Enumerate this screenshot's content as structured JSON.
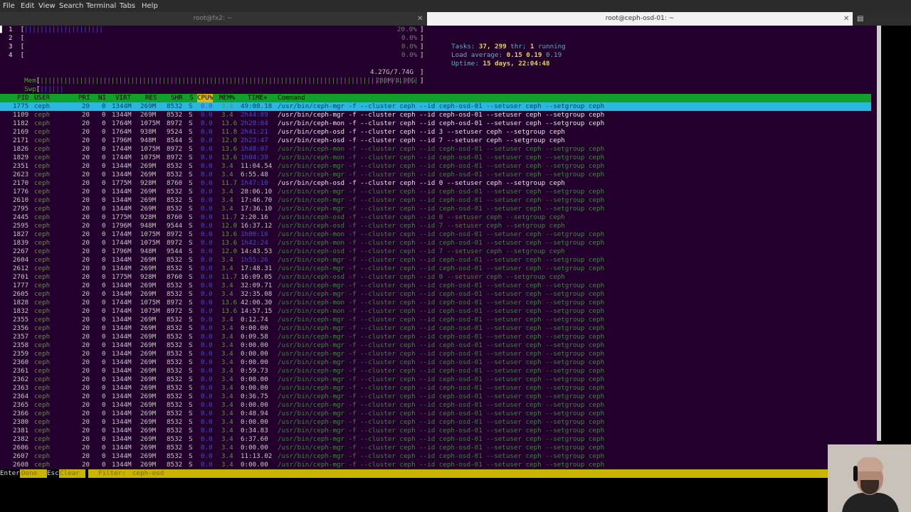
{
  "menu": [
    "File",
    "Edit",
    "View",
    "Search",
    "Terminal",
    "Tabs",
    "Help"
  ],
  "tabs": [
    {
      "title": "root@fx2: ~",
      "active": false
    },
    {
      "title": "root@ceph-osd-01: ~",
      "active": true
    }
  ],
  "meters": {
    "cpus": [
      {
        "label": "1",
        "value": "20.0%"
      },
      {
        "label": "2",
        "value": "0.0%"
      },
      {
        "label": "3",
        "value": "0.0%"
      },
      {
        "label": "4",
        "value": "0.0%"
      }
    ],
    "mem": {
      "label": "Mem",
      "value": "4.27G/7.74G"
    },
    "swp": {
      "label": "Swp",
      "value": "280M/4.00G"
    }
  },
  "summary": {
    "tasks_label": "Tasks:",
    "tasks": "37,",
    "threads": "299",
    "thr_label": "thr;",
    "running": "1",
    "running_label": "running",
    "load_label": "Load average:",
    "load1": "0.15",
    "load5": "0.19",
    "load15": "0.19",
    "uptime_label": "Uptime:",
    "uptime": "15 days, 22:04:48"
  },
  "columns": [
    "PID",
    "USER",
    "PRI",
    "NI",
    "VIRT",
    "RES",
    "SHR",
    "S",
    "CPU%",
    "MEM%",
    "TIME+",
    "Command"
  ],
  "rows": [
    {
      "pid": "1775",
      "user": "ceph",
      "pri": "20",
      "ni": "0",
      "virt": "1344M",
      "res": "269M",
      "shr": "8532",
      "s": "S",
      "cpu": "0.0",
      "mem": "3.4",
      "time": "49:08.18",
      "cmd": "/usr/bin/ceph-mgr -f --cluster ceph --id ceph-osd-01 --setuser ceph --setgroup ceph",
      "kind": "sel"
    },
    {
      "pid": "1109",
      "user": "ceph",
      "pri": "20",
      "ni": "0",
      "virt": "1344M",
      "res": "269M",
      "shr": "8532",
      "s": "S",
      "cpu": "0.0",
      "mem": "3.4",
      "time": "2h44:09",
      "cmd": "/usr/bin/ceph-mgr -f --cluster ceph --id ceph-osd-01 --setuser ceph --setgroup ceph",
      "kind": "proc"
    },
    {
      "pid": "1182",
      "user": "ceph",
      "pri": "20",
      "ni": "0",
      "virt": "1764M",
      "res": "1075M",
      "shr": "8972",
      "s": "S",
      "cpu": "0.0",
      "mem": "13.6",
      "time": "2h28:04",
      "cmd": "/usr/bin/ceph-mon -f --cluster ceph --id ceph-osd-01 --setuser ceph --setgroup ceph",
      "kind": "proc"
    },
    {
      "pid": "2169",
      "user": "ceph",
      "pri": "20",
      "ni": "0",
      "virt": "1764M",
      "res": "938M",
      "shr": "9524",
      "s": "S",
      "cpu": "0.0",
      "mem": "11.8",
      "time": "2h41:21",
      "cmd": "/usr/bin/ceph-osd -f --cluster ceph --id 3 --setuser ceph --setgroup ceph",
      "kind": "proc"
    },
    {
      "pid": "2171",
      "user": "ceph",
      "pri": "20",
      "ni": "0",
      "virt": "1796M",
      "res": "948M",
      "shr": "8544",
      "s": "S",
      "cpu": "0.0",
      "mem": "12.0",
      "time": "2h23:47",
      "cmd": "/usr/bin/ceph-osd -f --cluster ceph --id 7 --setuser ceph --setgroup ceph",
      "kind": "proc"
    },
    {
      "pid": "1826",
      "user": "ceph",
      "pri": "20",
      "ni": "0",
      "virt": "1744M",
      "res": "1075M",
      "shr": "8972",
      "s": "S",
      "cpu": "0.0",
      "mem": "13.6",
      "time": "1h48:07",
      "cmd": "/usr/bin/ceph-mon -f --cluster ceph --id ceph-osd-01 --setuser ceph --setgroup ceph",
      "kind": "thread"
    },
    {
      "pid": "1829",
      "user": "ceph",
      "pri": "20",
      "ni": "0",
      "virt": "1744M",
      "res": "1075M",
      "shr": "8972",
      "s": "S",
      "cpu": "0.0",
      "mem": "13.6",
      "time": "1h04:39",
      "cmd": "/usr/bin/ceph-mon -f --cluster ceph --id ceph-osd-01 --setuser ceph --setgroup ceph",
      "kind": "thread"
    },
    {
      "pid": "2351",
      "user": "ceph",
      "pri": "20",
      "ni": "0",
      "virt": "1344M",
      "res": "269M",
      "shr": "8532",
      "s": "S",
      "cpu": "0.0",
      "mem": "3.4",
      "time": "11:04.54",
      "cmd": "/usr/bin/ceph-mgr -f --cluster ceph --id ceph-osd-01 --setuser ceph --setgroup ceph",
      "kind": "thread"
    },
    {
      "pid": "2623",
      "user": "ceph",
      "pri": "20",
      "ni": "0",
      "virt": "1344M",
      "res": "269M",
      "shr": "8532",
      "s": "S",
      "cpu": "0.0",
      "mem": "3.4",
      "time": "6:55.48",
      "cmd": "/usr/bin/ceph-mgr -f --cluster ceph --id ceph-osd-01 --setuser ceph --setgroup ceph",
      "kind": "thread"
    },
    {
      "pid": "2170",
      "user": "ceph",
      "pri": "20",
      "ni": "0",
      "virt": "1775M",
      "res": "928M",
      "shr": "8760",
      "s": "S",
      "cpu": "0.0",
      "mem": "11.7",
      "time": "1h47:10",
      "cmd": "/usr/bin/ceph-osd -f --cluster ceph --id 0 --setuser ceph --setgroup ceph",
      "kind": "proc"
    },
    {
      "pid": "1776",
      "user": "ceph",
      "pri": "20",
      "ni": "0",
      "virt": "1344M",
      "res": "269M",
      "shr": "8532",
      "s": "S",
      "cpu": "0.0",
      "mem": "3.4",
      "time": "28:06.10",
      "cmd": "/usr/bin/ceph-mgr -f --cluster ceph --id ceph-osd-01 --setuser ceph --setgroup ceph",
      "kind": "thread"
    },
    {
      "pid": "2610",
      "user": "ceph",
      "pri": "20",
      "ni": "0",
      "virt": "1344M",
      "res": "269M",
      "shr": "8532",
      "s": "S",
      "cpu": "0.0",
      "mem": "3.4",
      "time": "17:46.70",
      "cmd": "/usr/bin/ceph-mgr -f --cluster ceph --id ceph-osd-01 --setuser ceph --setgroup ceph",
      "kind": "thread"
    },
    {
      "pid": "2795",
      "user": "ceph",
      "pri": "20",
      "ni": "0",
      "virt": "1344M",
      "res": "269M",
      "shr": "8532",
      "s": "S",
      "cpu": "0.0",
      "mem": "3.4",
      "time": "17:36.10",
      "cmd": "/usr/bin/ceph-mgr -f --cluster ceph --id ceph-osd-01 --setuser ceph --setgroup ceph",
      "kind": "thread"
    },
    {
      "pid": "2445",
      "user": "ceph",
      "pri": "20",
      "ni": "0",
      "virt": "1775M",
      "res": "928M",
      "shr": "8760",
      "s": "S",
      "cpu": "0.0",
      "mem": "11.7",
      "time": "2:20.16",
      "cmd": "/usr/bin/ceph-osd -f --cluster ceph --id 0 --setuser ceph --setgroup ceph",
      "kind": "thread"
    },
    {
      "pid": "2595",
      "user": "ceph",
      "pri": "20",
      "ni": "0",
      "virt": "1796M",
      "res": "948M",
      "shr": "9544",
      "s": "S",
      "cpu": "0.0",
      "mem": "12.0",
      "time": "16:37.12",
      "cmd": "/usr/bin/ceph-osd -f --cluster ceph --id 7 --setuser ceph --setgroup ceph",
      "kind": "thread"
    },
    {
      "pid": "1827",
      "user": "ceph",
      "pri": "20",
      "ni": "0",
      "virt": "1744M",
      "res": "1075M",
      "shr": "8972",
      "s": "S",
      "cpu": "0.0",
      "mem": "13.6",
      "time": "1h00:16",
      "cmd": "/usr/bin/ceph-mon -f --cluster ceph --id ceph-osd-01 --setuser ceph --setgroup ceph",
      "kind": "thread"
    },
    {
      "pid": "1839",
      "user": "ceph",
      "pri": "20",
      "ni": "0",
      "virt": "1744M",
      "res": "1075M",
      "shr": "8972",
      "s": "S",
      "cpu": "0.0",
      "mem": "13.6",
      "time": "1h42:24",
      "cmd": "/usr/bin/ceph-mon -f --cluster ceph --id ceph-osd-01 --setuser ceph --setgroup ceph",
      "kind": "thread"
    },
    {
      "pid": "2267",
      "user": "ceph",
      "pri": "20",
      "ni": "0",
      "virt": "1796M",
      "res": "948M",
      "shr": "9544",
      "s": "S",
      "cpu": "0.0",
      "mem": "12.0",
      "time": "14:43.53",
      "cmd": "/usr/bin/ceph-osd -f --cluster ceph --id 7 --setuser ceph --setgroup ceph",
      "kind": "thread"
    },
    {
      "pid": "2604",
      "user": "ceph",
      "pri": "20",
      "ni": "0",
      "virt": "1344M",
      "res": "269M",
      "shr": "8532",
      "s": "S",
      "cpu": "0.0",
      "mem": "3.4",
      "time": "1h55:26",
      "cmd": "/usr/bin/ceph-mgr -f --cluster ceph --id ceph-osd-01 --setuser ceph --setgroup ceph",
      "kind": "thread"
    },
    {
      "pid": "2612",
      "user": "ceph",
      "pri": "20",
      "ni": "0",
      "virt": "1344M",
      "res": "269M",
      "shr": "8532",
      "s": "S",
      "cpu": "0.0",
      "mem": "3.4",
      "time": "17:48.31",
      "cmd": "/usr/bin/ceph-mgr -f --cluster ceph --id ceph-osd-01 --setuser ceph --setgroup ceph",
      "kind": "thread"
    },
    {
      "pid": "2701",
      "user": "ceph",
      "pri": "20",
      "ni": "0",
      "virt": "1775M",
      "res": "928M",
      "shr": "8760",
      "s": "S",
      "cpu": "0.0",
      "mem": "11.7",
      "time": "16:09.05",
      "cmd": "/usr/bin/ceph-osd -f --cluster ceph --id 0 --setuser ceph --setgroup ceph",
      "kind": "thread"
    },
    {
      "pid": "1777",
      "user": "ceph",
      "pri": "20",
      "ni": "0",
      "virt": "1344M",
      "res": "269M",
      "shr": "8532",
      "s": "S",
      "cpu": "0.0",
      "mem": "3.4",
      "time": "32:09.71",
      "cmd": "/usr/bin/ceph-mgr -f --cluster ceph --id ceph-osd-01 --setuser ceph --setgroup ceph",
      "kind": "thread"
    },
    {
      "pid": "2605",
      "user": "ceph",
      "pri": "20",
      "ni": "0",
      "virt": "1344M",
      "res": "269M",
      "shr": "8532",
      "s": "S",
      "cpu": "0.0",
      "mem": "3.4",
      "time": "32:35.08",
      "cmd": "/usr/bin/ceph-mgr -f --cluster ceph --id ceph-osd-01 --setuser ceph --setgroup ceph",
      "kind": "thread"
    },
    {
      "pid": "1828",
      "user": "ceph",
      "pri": "20",
      "ni": "0",
      "virt": "1744M",
      "res": "1075M",
      "shr": "8972",
      "s": "S",
      "cpu": "0.0",
      "mem": "13.6",
      "time": "42:00.30",
      "cmd": "/usr/bin/ceph-mon -f --cluster ceph --id ceph-osd-01 --setuser ceph --setgroup ceph",
      "kind": "thread"
    },
    {
      "pid": "1832",
      "user": "ceph",
      "pri": "20",
      "ni": "0",
      "virt": "1744M",
      "res": "1075M",
      "shr": "8972",
      "s": "S",
      "cpu": "0.0",
      "mem": "13.6",
      "time": "14:57.15",
      "cmd": "/usr/bin/ceph-mon -f --cluster ceph --id ceph-osd-01 --setuser ceph --setgroup ceph",
      "kind": "thread"
    },
    {
      "pid": "2355",
      "user": "ceph",
      "pri": "20",
      "ni": "0",
      "virt": "1344M",
      "res": "269M",
      "shr": "8532",
      "s": "S",
      "cpu": "0.0",
      "mem": "3.4",
      "time": "0:12.74",
      "cmd": "/usr/bin/ceph-mgr -f --cluster ceph --id ceph-osd-01 --setuser ceph --setgroup ceph",
      "kind": "thread"
    },
    {
      "pid": "2356",
      "user": "ceph",
      "pri": "20",
      "ni": "0",
      "virt": "1344M",
      "res": "269M",
      "shr": "8532",
      "s": "S",
      "cpu": "0.0",
      "mem": "3.4",
      "time": "0:00.00",
      "cmd": "/usr/bin/ceph-mgr -f --cluster ceph --id ceph-osd-01 --setuser ceph --setgroup ceph",
      "kind": "thread"
    },
    {
      "pid": "2357",
      "user": "ceph",
      "pri": "20",
      "ni": "0",
      "virt": "1344M",
      "res": "269M",
      "shr": "8532",
      "s": "S",
      "cpu": "0.0",
      "mem": "3.4",
      "time": "0:09.58",
      "cmd": "/usr/bin/ceph-mgr -f --cluster ceph --id ceph-osd-01 --setuser ceph --setgroup ceph",
      "kind": "thread"
    },
    {
      "pid": "2358",
      "user": "ceph",
      "pri": "20",
      "ni": "0",
      "virt": "1344M",
      "res": "269M",
      "shr": "8532",
      "s": "S",
      "cpu": "0.0",
      "mem": "3.4",
      "time": "0:00.00",
      "cmd": "/usr/bin/ceph-mgr -f --cluster ceph --id ceph-osd-01 --setuser ceph --setgroup ceph",
      "kind": "thread"
    },
    {
      "pid": "2359",
      "user": "ceph",
      "pri": "20",
      "ni": "0",
      "virt": "1344M",
      "res": "269M",
      "shr": "8532",
      "s": "S",
      "cpu": "0.0",
      "mem": "3.4",
      "time": "0:00.00",
      "cmd": "/usr/bin/ceph-mgr -f --cluster ceph --id ceph-osd-01 --setuser ceph --setgroup ceph",
      "kind": "thread"
    },
    {
      "pid": "2360",
      "user": "ceph",
      "pri": "20",
      "ni": "0",
      "virt": "1344M",
      "res": "269M",
      "shr": "8532",
      "s": "S",
      "cpu": "0.0",
      "mem": "3.4",
      "time": "0:00.00",
      "cmd": "/usr/bin/ceph-mgr -f --cluster ceph --id ceph-osd-01 --setuser ceph --setgroup ceph",
      "kind": "thread"
    },
    {
      "pid": "2361",
      "user": "ceph",
      "pri": "20",
      "ni": "0",
      "virt": "1344M",
      "res": "269M",
      "shr": "8532",
      "s": "S",
      "cpu": "0.0",
      "mem": "3.4",
      "time": "0:59.73",
      "cmd": "/usr/bin/ceph-mgr -f --cluster ceph --id ceph-osd-01 --setuser ceph --setgroup ceph",
      "kind": "thread"
    },
    {
      "pid": "2362",
      "user": "ceph",
      "pri": "20",
      "ni": "0",
      "virt": "1344M",
      "res": "269M",
      "shr": "8532",
      "s": "S",
      "cpu": "0.0",
      "mem": "3.4",
      "time": "0:00.00",
      "cmd": "/usr/bin/ceph-mgr -f --cluster ceph --id ceph-osd-01 --setuser ceph --setgroup ceph",
      "kind": "thread"
    },
    {
      "pid": "2363",
      "user": "ceph",
      "pri": "20",
      "ni": "0",
      "virt": "1344M",
      "res": "269M",
      "shr": "8532",
      "s": "S",
      "cpu": "0.0",
      "mem": "3.4",
      "time": "0:00.00",
      "cmd": "/usr/bin/ceph-mgr -f --cluster ceph --id ceph-osd-01 --setuser ceph --setgroup ceph",
      "kind": "thread"
    },
    {
      "pid": "2364",
      "user": "ceph",
      "pri": "20",
      "ni": "0",
      "virt": "1344M",
      "res": "269M",
      "shr": "8532",
      "s": "S",
      "cpu": "0.0",
      "mem": "3.4",
      "time": "0:36.75",
      "cmd": "/usr/bin/ceph-mgr -f --cluster ceph --id ceph-osd-01 --setuser ceph --setgroup ceph",
      "kind": "thread"
    },
    {
      "pid": "2365",
      "user": "ceph",
      "pri": "20",
      "ni": "0",
      "virt": "1344M",
      "res": "269M",
      "shr": "8532",
      "s": "S",
      "cpu": "0.0",
      "mem": "3.4",
      "time": "0:00.00",
      "cmd": "/usr/bin/ceph-mgr -f --cluster ceph --id ceph-osd-01 --setuser ceph --setgroup ceph",
      "kind": "thread"
    },
    {
      "pid": "2366",
      "user": "ceph",
      "pri": "20",
      "ni": "0",
      "virt": "1344M",
      "res": "269M",
      "shr": "8532",
      "s": "S",
      "cpu": "0.0",
      "mem": "3.4",
      "time": "0:48.94",
      "cmd": "/usr/bin/ceph-mgr -f --cluster ceph --id ceph-osd-01 --setuser ceph --setgroup ceph",
      "kind": "thread"
    },
    {
      "pid": "2380",
      "user": "ceph",
      "pri": "20",
      "ni": "0",
      "virt": "1344M",
      "res": "269M",
      "shr": "8532",
      "s": "S",
      "cpu": "0.0",
      "mem": "3.4",
      "time": "0:00.00",
      "cmd": "/usr/bin/ceph-mgr -f --cluster ceph --id ceph-osd-01 --setuser ceph --setgroup ceph",
      "kind": "thread"
    },
    {
      "pid": "2381",
      "user": "ceph",
      "pri": "20",
      "ni": "0",
      "virt": "1344M",
      "res": "269M",
      "shr": "8532",
      "s": "S",
      "cpu": "0.0",
      "mem": "3.4",
      "time": "0:34.83",
      "cmd": "/usr/bin/ceph-mgr -f --cluster ceph --id ceph-osd-01 --setuser ceph --setgroup ceph",
      "kind": "thread"
    },
    {
      "pid": "2382",
      "user": "ceph",
      "pri": "20",
      "ni": "0",
      "virt": "1344M",
      "res": "269M",
      "shr": "8532",
      "s": "S",
      "cpu": "0.0",
      "mem": "3.4",
      "time": "6:37.60",
      "cmd": "/usr/bin/ceph-mgr -f --cluster ceph --id ceph-osd-01 --setuser ceph --setgroup ceph",
      "kind": "thread"
    },
    {
      "pid": "2606",
      "user": "ceph",
      "pri": "20",
      "ni": "0",
      "virt": "1344M",
      "res": "269M",
      "shr": "8532",
      "s": "S",
      "cpu": "0.0",
      "mem": "3.4",
      "time": "0:00.00",
      "cmd": "/usr/bin/ceph-mgr -f --cluster ceph --id ceph-osd-01 --setuser ceph --setgroup ceph",
      "kind": "thread"
    },
    {
      "pid": "2607",
      "user": "ceph",
      "pri": "20",
      "ni": "0",
      "virt": "1344M",
      "res": "269M",
      "shr": "8532",
      "s": "S",
      "cpu": "0.0",
      "mem": "3.4",
      "time": "11:13.02",
      "cmd": "/usr/bin/ceph-mgr -f --cluster ceph --id ceph-osd-01 --setuser ceph --setgroup ceph",
      "kind": "thread"
    },
    {
      "pid": "2608",
      "user": "ceph",
      "pri": "20",
      "ni": "0",
      "virt": "1344M",
      "res": "269M",
      "shr": "8532",
      "s": "S",
      "cpu": "0.0",
      "mem": "3.4",
      "time": "0:00.00",
      "cmd": "/usr/bin/ceph-mgr -f --cluster ceph --id ceph-osd-01 --setuser ceph --setgroup ceph",
      "kind": "thread"
    }
  ],
  "footer": {
    "enter_key": "Enter",
    "enter_label": "Done",
    "esc_key": "Esc",
    "esc_label": "Clear",
    "filter_label": "Filter:",
    "filter_value": "ceph-osd"
  },
  "colors": {
    "terminal_bg": "#23002b",
    "header_bg": "#11a02a",
    "selected_bg": "#2ab8e0",
    "footer_bg": "#c8b400"
  }
}
